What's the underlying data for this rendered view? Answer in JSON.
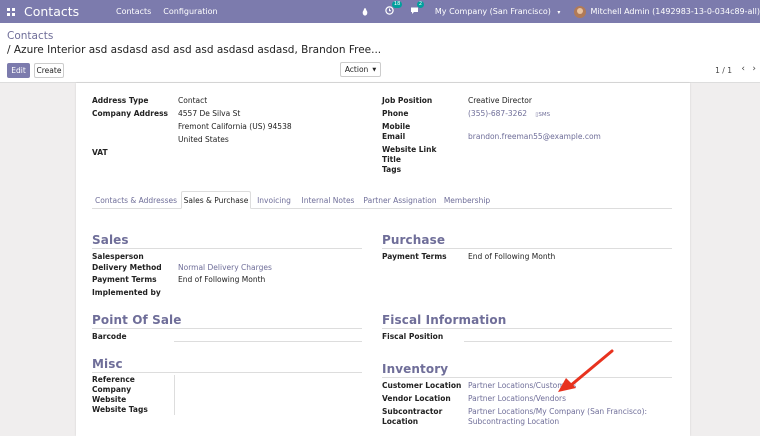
{
  "navbar": {
    "app_title": "Contacts",
    "menu": [
      "Contacts",
      "Configuration"
    ],
    "activity_count": "18",
    "messages_count": "2",
    "company": "My Company (San Francisco)",
    "user": "Mitchell Admin (1492983-13-0-034c89-all)",
    "icons": [
      "apps-grid-icon",
      "bug-icon",
      "clock-icon",
      "chat-icon",
      "chevron-down-icon"
    ],
    "bar_color": "#7c7bad"
  },
  "breadcrumb": {
    "parent": "Contacts",
    "current": "/ Azure Interior asd asdasd asd asd asd asdasd asdasd, Brandon Free..."
  },
  "toolbar": {
    "edit_label": "Edit",
    "create_label": "Create",
    "action_label": "Action",
    "pager": "1 / 1"
  },
  "partner": {
    "left": [
      {
        "label": "Address Type",
        "value": "Contact"
      },
      {
        "label": "Company Address",
        "lines": [
          "4557 De Silva St",
          "Fremont  California (US)  94538",
          "United States"
        ]
      },
      {
        "label": "VAT",
        "value": ""
      }
    ],
    "right": [
      {
        "label": "Job Position",
        "value": "Creative Director"
      },
      {
        "label": "Phone",
        "value": "(355)-687-3262",
        "extra": "SMS"
      },
      {
        "label": "Mobile",
        "value": ""
      },
      {
        "label": "Email",
        "value": "brandon.freeman55@example.com"
      },
      {
        "label": "Website Link",
        "value": ""
      },
      {
        "label": "Title",
        "value": ""
      },
      {
        "label": "Tags",
        "value": ""
      }
    ]
  },
  "tabs": [
    "Contacts & Addresses",
    "Sales & Purchase",
    "Invoicing",
    "Internal Notes",
    "Partner Assignation",
    "Membership"
  ],
  "active_tab": "Sales & Purchase",
  "sales": {
    "title": "Sales",
    "rows": [
      {
        "label": "Salesperson",
        "value": ""
      },
      {
        "label": "Delivery Method",
        "value": "Normal Delivery Charges"
      },
      {
        "label": "Payment Terms",
        "value": "End of Following Month"
      },
      {
        "label": "Implemented by",
        "value": ""
      }
    ]
  },
  "purchase": {
    "title": "Purchase",
    "rows": [
      {
        "label": "Payment Terms",
        "value": "End of Following Month"
      }
    ]
  },
  "pos": {
    "title": "Point Of Sale",
    "rows": [
      {
        "label": "Barcode",
        "value": ""
      }
    ]
  },
  "fiscal": {
    "title": "Fiscal Information",
    "rows": [
      {
        "label": "Fiscal Position",
        "value": ""
      }
    ]
  },
  "misc": {
    "title": "Misc",
    "rows": [
      {
        "label": "Reference",
        "value": ""
      },
      {
        "label": "Company",
        "value": ""
      },
      {
        "label": "Website",
        "value": ""
      },
      {
        "label": "Website Tags",
        "value": ""
      }
    ]
  },
  "inventory": {
    "title": "Inventory",
    "rows": [
      {
        "label": "Customer Location",
        "value": "Partner Locations/Customers"
      },
      {
        "label": "Vendor Location",
        "value": "Partner Locations/Vendors"
      },
      {
        "label": "Subcontractor",
        "label2": "Location",
        "value": "Partner Locations/My Company (San Francisco):",
        "value2": "Subcontracting Location"
      }
    ]
  },
  "annotation_arrow_color": "#e8321e"
}
